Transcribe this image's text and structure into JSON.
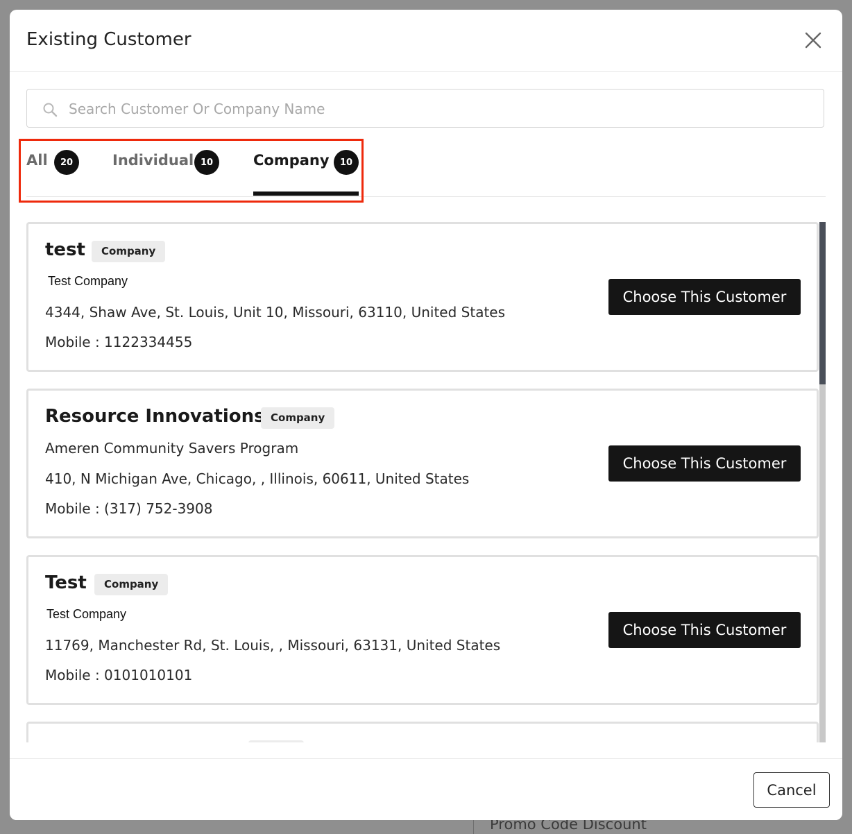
{
  "modal": {
    "title": "Existing Customer",
    "search_placeholder": "Search Customer Or Company Name",
    "cancel_label": "Cancel"
  },
  "tabs": [
    {
      "label": "All",
      "count": "20",
      "active": false
    },
    {
      "label": "Individual",
      "count": "10",
      "active": false
    },
    {
      "label": "Company",
      "count": "10",
      "active": true
    }
  ],
  "customers": [
    {
      "name": "test",
      "type": "Company",
      "company": "Test Company",
      "address": "4344, Shaw Ave, St. Louis, Unit 10, Missouri, 63110, United States",
      "mobile": "Mobile : 1122334455",
      "action": "Choose This Customer"
    },
    {
      "name": "Resource Innovations",
      "type": "Company",
      "company": "Ameren Community Savers Program",
      "address": "410, N Michigan Ave, Chicago, , Illinois, 60611, United States",
      "mobile": "Mobile : (317) 752-3908",
      "action": "Choose This Customer"
    },
    {
      "name": "Test",
      "type": "Company",
      "company": "Test Company",
      "address": "11769, Manchester Rd, St. Louis, , Missouri, 63131, United States",
      "mobile": "Mobile : 0101010101",
      "action": "Choose This Customer"
    }
  ],
  "background": {
    "promo_label": "Promo Code Discount"
  },
  "colors": {
    "highlight_border": "#ee2a0c",
    "button_bg": "#151515",
    "badge_bg": "#111111"
  }
}
